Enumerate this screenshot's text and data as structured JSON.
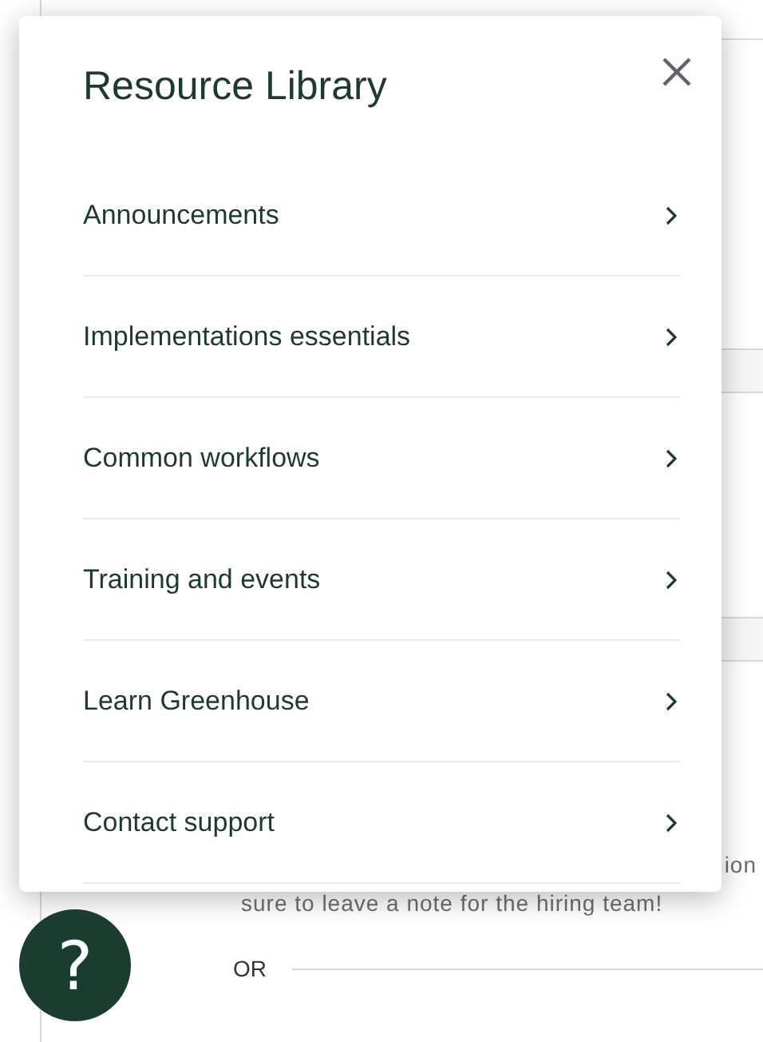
{
  "page": {
    "text_fragment": "ion",
    "note": "sure to leave a note for the hiring team!",
    "separator_label": "OR"
  },
  "resource_library": {
    "title": "Resource Library",
    "items": [
      {
        "label": "Announcements"
      },
      {
        "label": "Implementations essentials"
      },
      {
        "label": "Common workflows"
      },
      {
        "label": "Training and events"
      },
      {
        "label": "Learn Greenhouse"
      },
      {
        "label": "Contact support"
      }
    ]
  },
  "help_button": {
    "label": "?"
  }
}
